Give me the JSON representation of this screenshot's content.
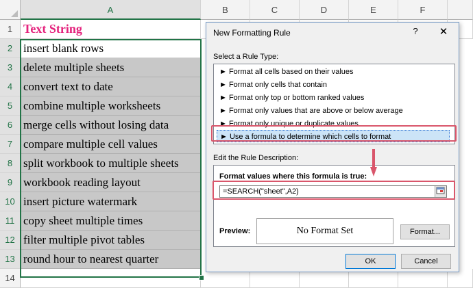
{
  "sheet": {
    "columns": [
      "A",
      "B",
      "C",
      "D",
      "E",
      "F"
    ],
    "rows": [
      "1",
      "2",
      "3",
      "4",
      "5",
      "6",
      "7",
      "8",
      "9",
      "10",
      "11",
      "12",
      "13",
      "14"
    ],
    "cells": [
      "Text String",
      "insert blank rows",
      "delete multiple sheets",
      "convert text to date",
      "combine multiple worksheets",
      "merge cells without losing data",
      "compare multiple cell values",
      "split workbook to multiple sheets",
      "workbook reading layout",
      "insert picture watermark",
      "copy sheet multiple times",
      "filter multiple pivot tables",
      "round hour to nearest quarter"
    ],
    "header_color": "#e4217c",
    "selection_color": "#c8c8c8"
  },
  "dialog": {
    "title": "New Formatting Rule",
    "help": "?",
    "close": "✕",
    "select_type_label": "Select a Rule Type:",
    "rule_types": [
      "► Format all cells based on their values",
      "► Format only cells that contain",
      "► Format only top or bottom ranked values",
      "► Format only values that are above or below average",
      "► Format only unique or duplicate values",
      "► Use a formula to determine which cells to format"
    ],
    "edit_label": "Edit the Rule Description:",
    "formula_label": "Format values where this formula is true:",
    "formula_value": "=SEARCH(\"sheet\",A2)",
    "preview_label": "Preview:",
    "preview_text": "No Format Set",
    "format_button": "Format...",
    "ok_button": "OK",
    "cancel_button": "Cancel",
    "highlight_color": "#d9566b"
  }
}
